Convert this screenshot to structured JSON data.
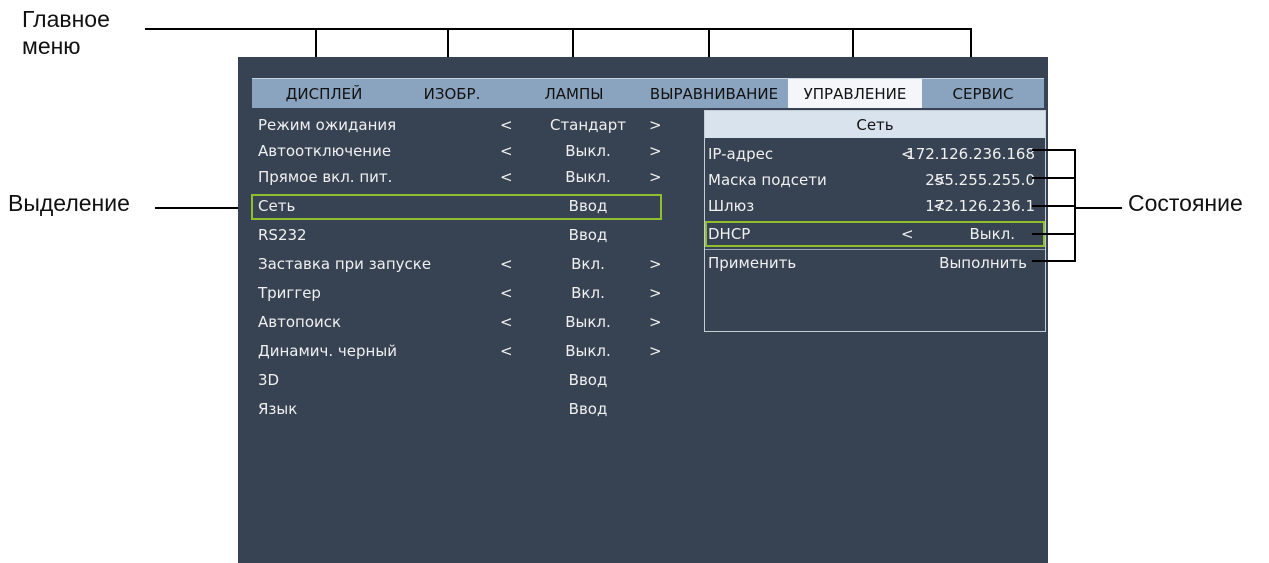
{
  "callouts": {
    "main_menu": [
      "Главное",
      "меню"
    ],
    "selection": "Выделение",
    "state": "Состояние"
  },
  "tabs": [
    {
      "label": "ДИСПЛЕЙ",
      "active": false
    },
    {
      "label": "ИЗОБР.",
      "active": false
    },
    {
      "label": "ЛАМПЫ",
      "active": false
    },
    {
      "label": "ВЫРАВНИВАНИЕ",
      "active": false
    },
    {
      "label": "УПРАВЛЕНИЕ",
      "active": true
    },
    {
      "label": "СЕРВИС",
      "active": false
    }
  ],
  "left_menu": [
    {
      "label": "Режим ожидания",
      "left_arrow": "<",
      "value": "Стандарт",
      "right_arrow": ">"
    },
    {
      "label": "Автоотключение",
      "left_arrow": "<",
      "value": "Выкл.",
      "right_arrow": ">"
    },
    {
      "label": "Прямое вкл. пит.",
      "left_arrow": "<",
      "value": "Выкл.",
      "right_arrow": ">"
    },
    {
      "label": "Сеть",
      "value": "Ввод",
      "selected": true
    },
    {
      "label": "RS232",
      "value": "Ввод"
    },
    {
      "label": "Заставка при запуске",
      "left_arrow": "<",
      "value": "Вкл.",
      "right_arrow": ">"
    },
    {
      "label": "Триггер",
      "left_arrow": "<",
      "value": "Вкл.",
      "right_arrow": ">"
    },
    {
      "label": "Автопоиск",
      "left_arrow": "<",
      "value": "Выкл.",
      "right_arrow": ">"
    },
    {
      "label": "Динамич. черный",
      "left_arrow": "<",
      "value": "Выкл.",
      "right_arrow": ">"
    },
    {
      "label": "3D",
      "value": "Ввод"
    },
    {
      "label": "Язык",
      "value": "Ввод"
    }
  ],
  "submenu": {
    "title": "Сеть",
    "rows": [
      {
        "label": "IP-адрес",
        "left_arrow": "<",
        "value": "172.126.236.168"
      },
      {
        "label": "Маска подсети",
        "left_arrow": "<",
        "value": "255.255.255.0"
      },
      {
        "label": "Шлюз",
        "left_arrow": "<",
        "value": "172.126.236.1"
      },
      {
        "label": "DHCP",
        "left_arrow": "<",
        "value": "Выкл.",
        "selected": true
      },
      {
        "label": "Применить",
        "value": "Выполнить"
      }
    ]
  },
  "colors": {
    "osd_background": "#374353",
    "tab_bar": "#8aa3bf",
    "active_tab": "#f4f6f9",
    "highlight": "#8fbe2e"
  }
}
